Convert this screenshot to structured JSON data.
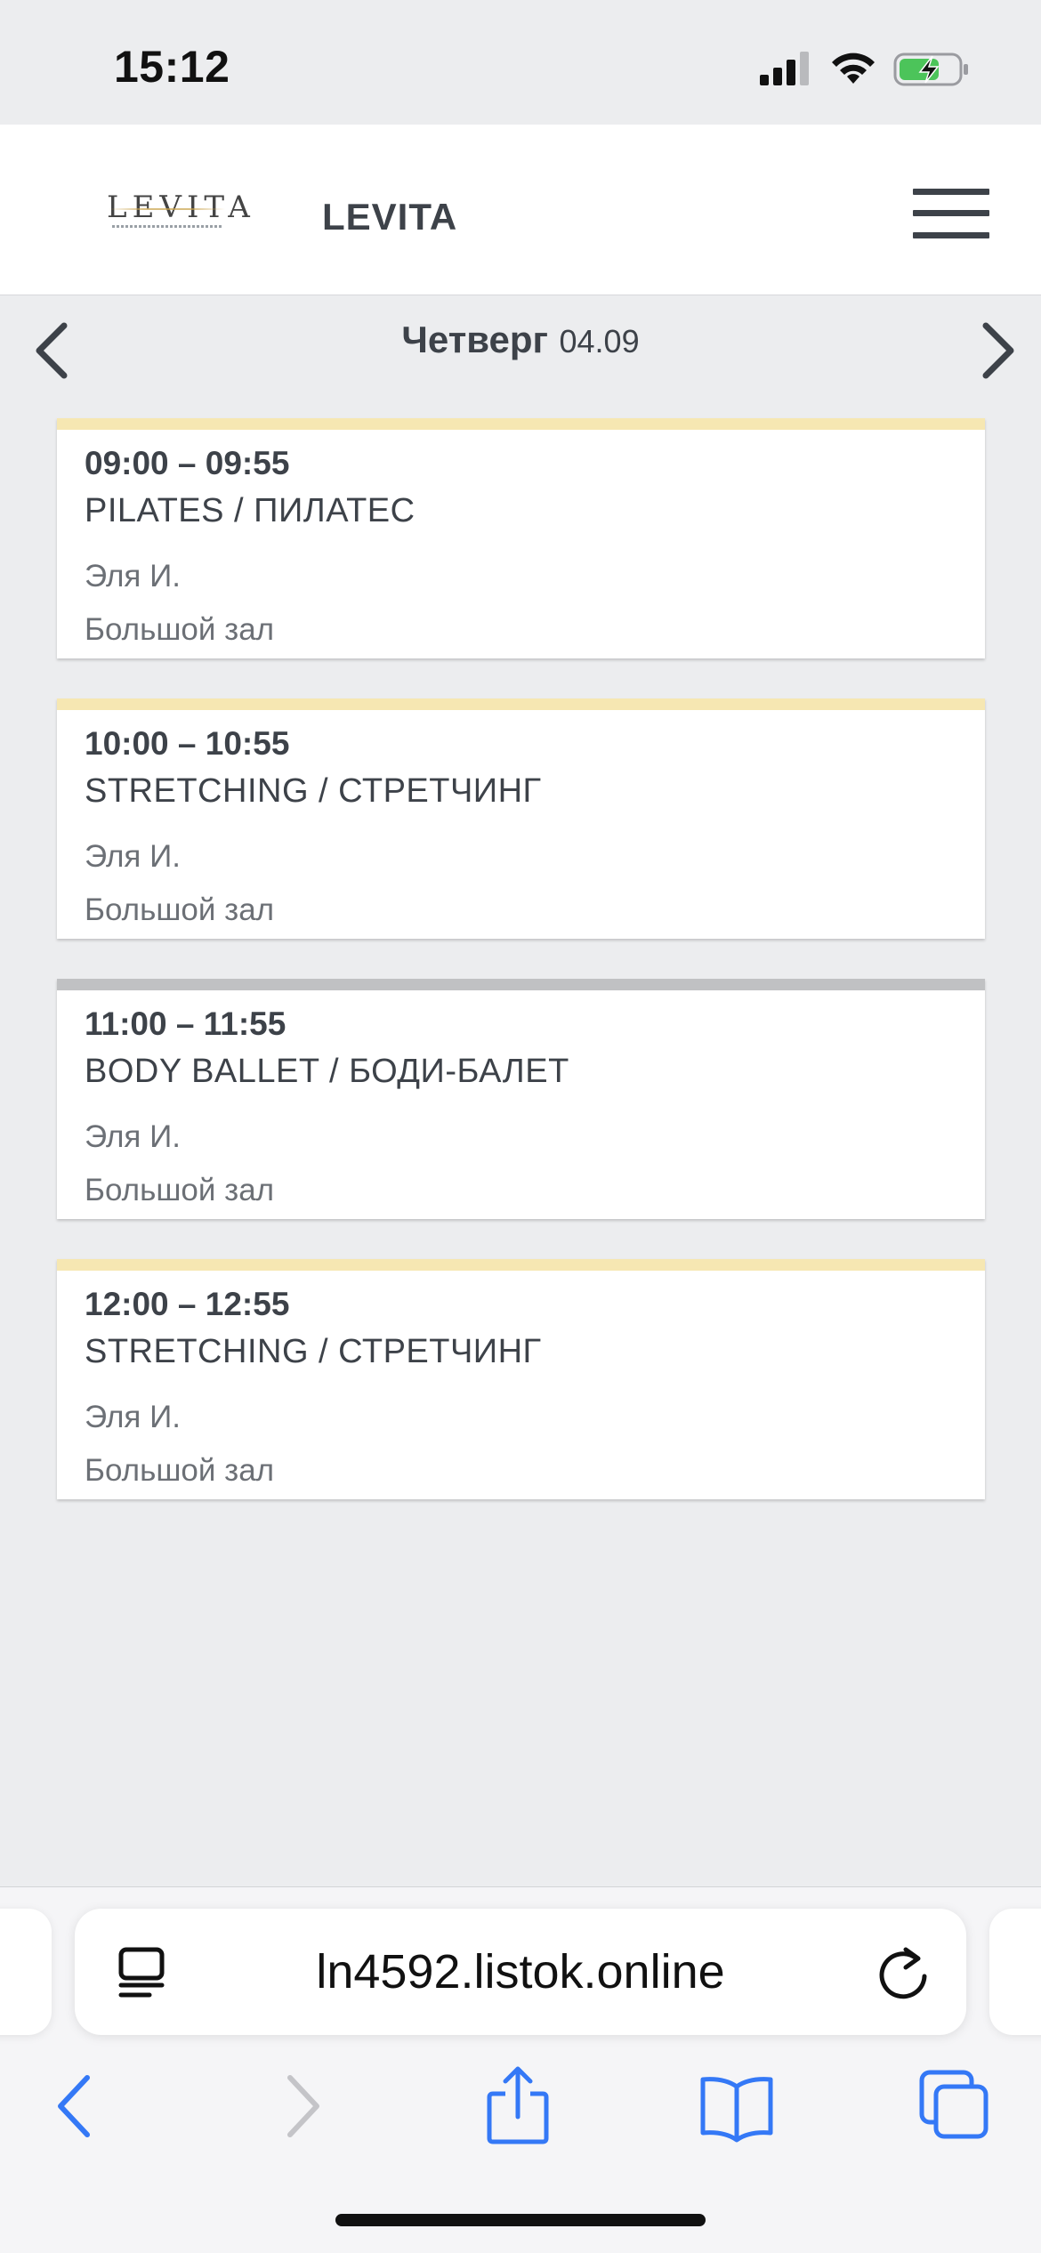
{
  "status_bar": {
    "time": "15:12"
  },
  "header": {
    "brand_name": "LEVITA",
    "logo_text": "LEVITA"
  },
  "day_nav": {
    "day_name": "Четверг",
    "date": "04.09"
  },
  "classes": [
    {
      "time": "09:00 – 09:55",
      "title": "PILATES / ПИЛАТЕС",
      "trainer": "Эля И.",
      "room": "Большой зал",
      "bar_color": "#f6e7b2"
    },
    {
      "time": "10:00 – 10:55",
      "title": "STRETCHING / СТРЕТЧИНГ",
      "trainer": "Эля И.",
      "room": "Большой зал",
      "bar_color": "#f6e7b2"
    },
    {
      "time": "11:00 – 11:55",
      "title": "BODY BALLET / БОДИ-БАЛЕТ",
      "trainer": "Эля И.",
      "room": "Большой зал",
      "bar_color": "#c0c1c3"
    },
    {
      "time": "12:00 – 12:55",
      "title": "STRETCHING / СТРЕТЧИНГ",
      "trainer": "Эля И.",
      "room": "Большой зал",
      "bar_color": "#f6e7b2"
    }
  ],
  "browser": {
    "url": "ln4592.listok.online"
  },
  "colors": {
    "accent_blue": "#3478f6",
    "disabled_gray": "#c4c4c8",
    "text_dark": "#3d4249"
  },
  "icons": {
    "reader": "reader-mode-icon",
    "reload": "reload-icon",
    "back": "back-chevron-icon",
    "forward": "forward-chevron-icon",
    "share": "share-icon",
    "bookmarks": "bookmarks-book-icon",
    "tabs": "tabs-icon"
  }
}
